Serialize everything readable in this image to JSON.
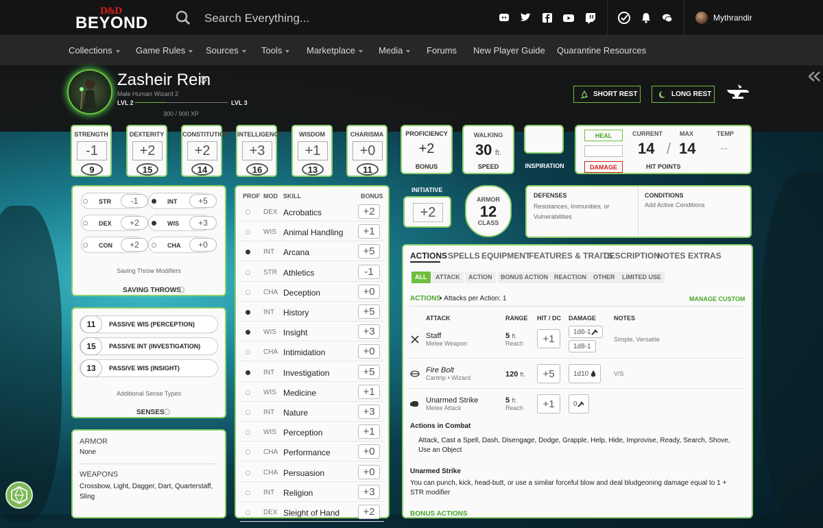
{
  "header": {
    "logo_top": "D&D",
    "logo_bottom": "BEYOND",
    "search_placeholder": "Search Everything...",
    "username": "Mythrandir"
  },
  "nav": {
    "items": [
      "Collections",
      "Game Rules",
      "Sources",
      "Tools",
      "Marketplace",
      "Media",
      "Forums",
      "New Player Guide",
      "Quarantine Resources"
    ]
  },
  "character": {
    "name": "Zasheir Rein",
    "subtitle": "Male  Human  Wizard 2",
    "level_current": "LVL 2",
    "level_next": "LVL 3",
    "xp": "300 / 900 XP",
    "xp_progress": 0.33,
    "short_rest": "SHORT REST",
    "long_rest": "LONG REST"
  },
  "abilities": [
    {
      "name": "STRENGTH",
      "mod": "-1",
      "score": "9"
    },
    {
      "name": "DEXTERITY",
      "mod": "+2",
      "score": "15"
    },
    {
      "name": "CONSTITUTION",
      "mod": "+2",
      "score": "14"
    },
    {
      "name": "INTELLIGENCE",
      "mod": "+3",
      "score": "16"
    },
    {
      "name": "WISDOM",
      "mod": "+1",
      "score": "13"
    },
    {
      "name": "CHARISMA",
      "mod": "+0",
      "score": "11"
    }
  ],
  "proficiency": {
    "title": "PROFICIENCY",
    "value": "+2",
    "label": "BONUS"
  },
  "speed": {
    "title": "WALKING",
    "value": "30",
    "unit": "ft.",
    "label": "SPEED"
  },
  "inspiration": {
    "label": "INSPIRATION"
  },
  "hp": {
    "heal": "HEAL",
    "damage": "DAMAGE",
    "current_label": "CURRENT",
    "max_label": "MAX",
    "temp_label": "TEMP",
    "current": "14",
    "sep": "/",
    "max": "14",
    "temp": "--",
    "label": "HIT POINTS"
  },
  "initiative": {
    "label": "INITIATIVE",
    "value": "+2"
  },
  "armor": {
    "top": "ARMOR",
    "value": "12",
    "bottom": "CLASS"
  },
  "defenses": {
    "title": "DEFENSES",
    "text": "Resistances, Immunities, or Vulnerabilities"
  },
  "conditions": {
    "title": "CONDITIONS",
    "text": "Add Active Conditions"
  },
  "saving_throws": {
    "items": [
      {
        "name": "STR",
        "value": "-1",
        "prof": false
      },
      {
        "name": "INT",
        "value": "+5",
        "prof": true
      },
      {
        "name": "DEX",
        "value": "+2",
        "prof": false
      },
      {
        "name": "WIS",
        "value": "+3",
        "prof": true
      },
      {
        "name": "CON",
        "value": "+2",
        "prof": false
      },
      {
        "name": "CHA",
        "value": "+0",
        "prof": false
      }
    ],
    "modifiers": "Saving Throw Modifiers",
    "title": "SAVING THROWS"
  },
  "senses": {
    "items": [
      {
        "value": "11",
        "label": "PASSIVE WIS (PERCEPTION)"
      },
      {
        "value": "15",
        "label": "PASSIVE INT (INVESTIGATION)"
      },
      {
        "value": "13",
        "label": "PASSIVE WIS (INSIGHT)"
      }
    ],
    "additional": "Additional Sense Types",
    "title": "SENSES"
  },
  "proficiencies": {
    "armor_title": "ARMOR",
    "armor": "None",
    "weapons_title": "WEAPONS",
    "weapons": "Crossbow, Light, Dagger, Dart, Quarterstaff, Sling"
  },
  "skills": {
    "headers": {
      "prof": "PROF",
      "mod": "MOD",
      "skill": "SKILL",
      "bonus": "BONUS"
    },
    "rows": [
      {
        "mod": "DEX",
        "name": "Acrobatics",
        "bonus": "+2",
        "prof": false
      },
      {
        "mod": "WIS",
        "name": "Animal Handling",
        "bonus": "+1",
        "prof": false
      },
      {
        "mod": "INT",
        "name": "Arcana",
        "bonus": "+5",
        "prof": true
      },
      {
        "mod": "STR",
        "name": "Athletics",
        "bonus": "-1",
        "prof": false
      },
      {
        "mod": "CHA",
        "name": "Deception",
        "bonus": "+0",
        "prof": false
      },
      {
        "mod": "INT",
        "name": "History",
        "bonus": "+5",
        "prof": true
      },
      {
        "mod": "WIS",
        "name": "Insight",
        "bonus": "+3",
        "prof": true
      },
      {
        "mod": "CHA",
        "name": "Intimidation",
        "bonus": "+0",
        "prof": false
      },
      {
        "mod": "INT",
        "name": "Investigation",
        "bonus": "+5",
        "prof": true
      },
      {
        "mod": "WIS",
        "name": "Medicine",
        "bonus": "+1",
        "prof": false
      },
      {
        "mod": "INT",
        "name": "Nature",
        "bonus": "+3",
        "prof": false
      },
      {
        "mod": "WIS",
        "name": "Perception",
        "bonus": "+1",
        "prof": false
      },
      {
        "mod": "CHA",
        "name": "Performance",
        "bonus": "+0",
        "prof": false
      },
      {
        "mod": "CHA",
        "name": "Persuasion",
        "bonus": "+0",
        "prof": false
      },
      {
        "mod": "INT",
        "name": "Religion",
        "bonus": "+3",
        "prof": false
      },
      {
        "mod": "DEX",
        "name": "Sleight of Hand",
        "bonus": "+2",
        "prof": false
      }
    ]
  },
  "tabs": [
    "ACTIONS",
    "SPELLS",
    "EQUIPMENT",
    "FEATURES & TRAITS",
    "DESCRIPTION",
    "NOTES",
    "EXTRAS"
  ],
  "subtabs": [
    "ALL",
    "ATTACK",
    "ACTION",
    "BONUS ACTION",
    "REACTION",
    "OTHER",
    "LIMITED USE"
  ],
  "actions": {
    "title": "ACTIONS",
    "attacks_per_action": "Attacks per Action: 1",
    "manage": "MANAGE CUSTOM",
    "headers": {
      "attack": "ATTACK",
      "range": "RANGE",
      "hit": "HIT / DC",
      "damage": "DAMAGE",
      "notes": "NOTES"
    },
    "attacks": [
      {
        "name": "Staff",
        "sub": "Melee Weapon",
        "range": "5",
        "range_unit": "ft.",
        "range_sub": "Reach",
        "hit": "+1",
        "damage": "1d6-1",
        "damage2": "1d8-1",
        "notes": "Simple, Versatile"
      },
      {
        "name": "Fire Bolt",
        "sub": "Cantrip • Wizard",
        "range": "120",
        "range_unit": "ft.",
        "range_sub": "",
        "hit": "+5",
        "damage": "1d10",
        "damage2": "",
        "notes": "V/S"
      },
      {
        "name": "Unarmed Strike",
        "sub": "Melee Attack",
        "range": "5",
        "range_unit": "ft.",
        "range_sub": "Reach",
        "hit": "+1",
        "damage": "0",
        "damage2": "",
        "notes": ""
      }
    ],
    "combat_title": "Actions in Combat",
    "combat_text": "Attack,  Cast a Spell,  Dash,  Disengage,  Dodge,  Grapple,  Help,  Hide,  Improvise,  Ready,  Search,  Shove,  Use an Object",
    "unarmed_title": "Unarmed Strike",
    "unarmed_text": "You can punch, kick, head-butt, or use a similar forceful blow and deal bludgeoning damage equal to 1 + STR modifier",
    "bonus_title": "BONUS ACTIONS"
  },
  "colors": {
    "accent": "#6fbf3f",
    "red": "#d41e1e",
    "topbar": "#141414",
    "navbar": "#272727"
  }
}
